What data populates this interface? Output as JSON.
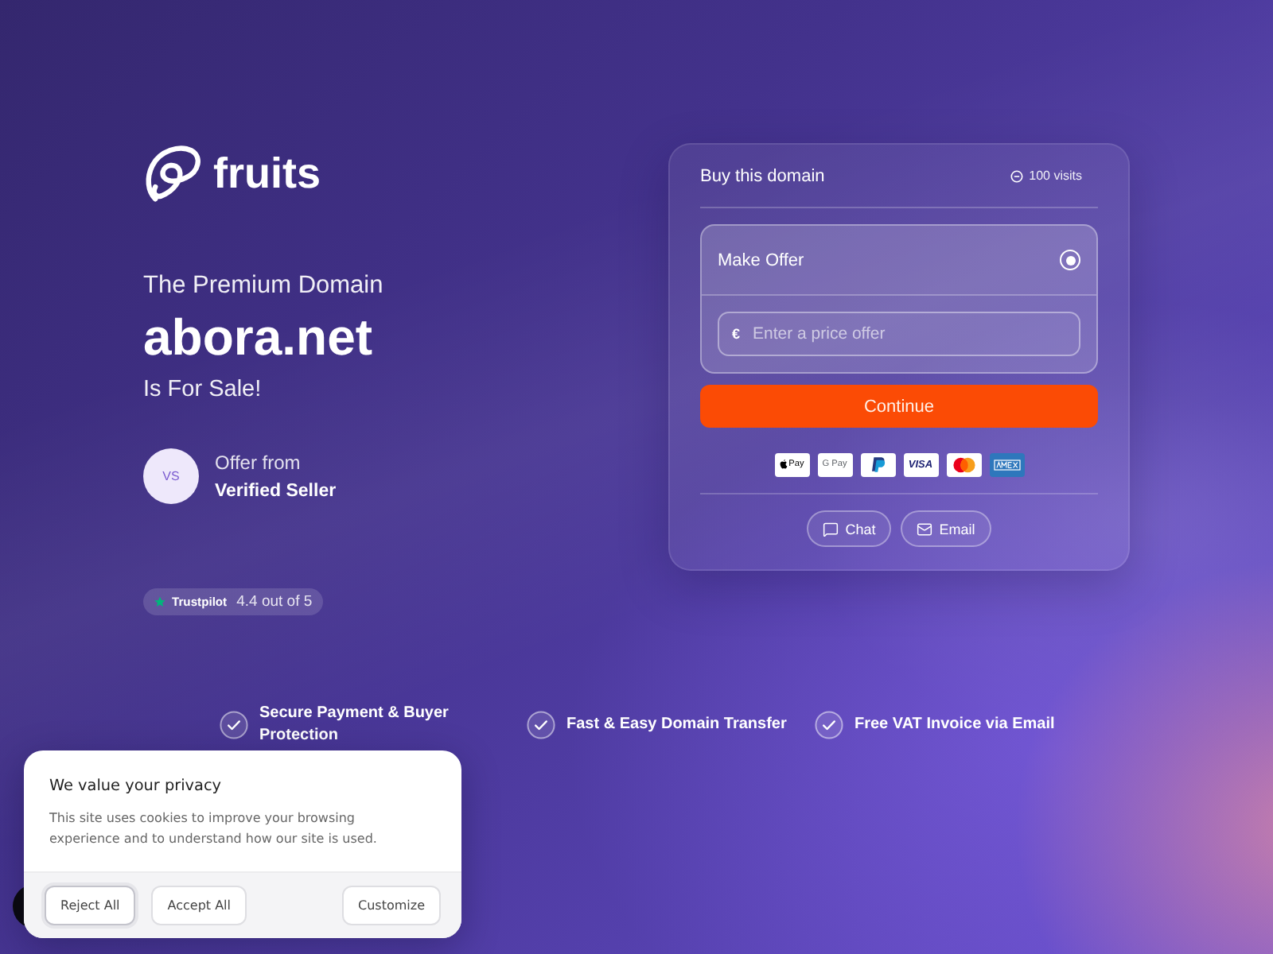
{
  "brand": {
    "name": "fruits"
  },
  "hero": {
    "kicker": "The Premium Domain",
    "domain": "abora.net",
    "tagline": "Is For Sale!"
  },
  "seller": {
    "initials": "VS",
    "label": "Offer from",
    "name": "Verified Seller"
  },
  "rating": {
    "source": "Trustpilot",
    "score": "4.4 out of 5"
  },
  "purchase_card": {
    "title": "Buy this domain",
    "visits": "100 visits",
    "options": [
      {
        "label": "Make Offer",
        "selected": true
      }
    ],
    "price_field": {
      "currency": "€",
      "placeholder": "Enter a price offer"
    },
    "submit_button": "Continue",
    "payment_methods": [
      {
        "kind": "apple_pay",
        "label": "Pay"
      },
      {
        "kind": "google_pay",
        "label": "G Pay"
      },
      {
        "kind": "paypal"
      },
      {
        "kind": "visa",
        "label": "VISA"
      },
      {
        "kind": "mastercard"
      },
      {
        "kind": "amex"
      }
    ],
    "contact_buttons": [
      {
        "kind": "chat",
        "label": "Chat"
      },
      {
        "kind": "email",
        "label": "Email"
      }
    ]
  },
  "features": [
    "Secure Payment & Buyer Protection",
    "Fast & Easy Domain Transfer",
    "Free VAT Invoice via Email"
  ],
  "cookie_banner": {
    "title": "We value your privacy",
    "text": "This site uses cookies to improve your browsing experience and to understand how our site is used.",
    "buttons": [
      {
        "label": "Reject All",
        "focused": true
      },
      {
        "label": "Accept All",
        "focused": false
      },
      {
        "label": "Customize",
        "focused": false
      }
    ]
  }
}
